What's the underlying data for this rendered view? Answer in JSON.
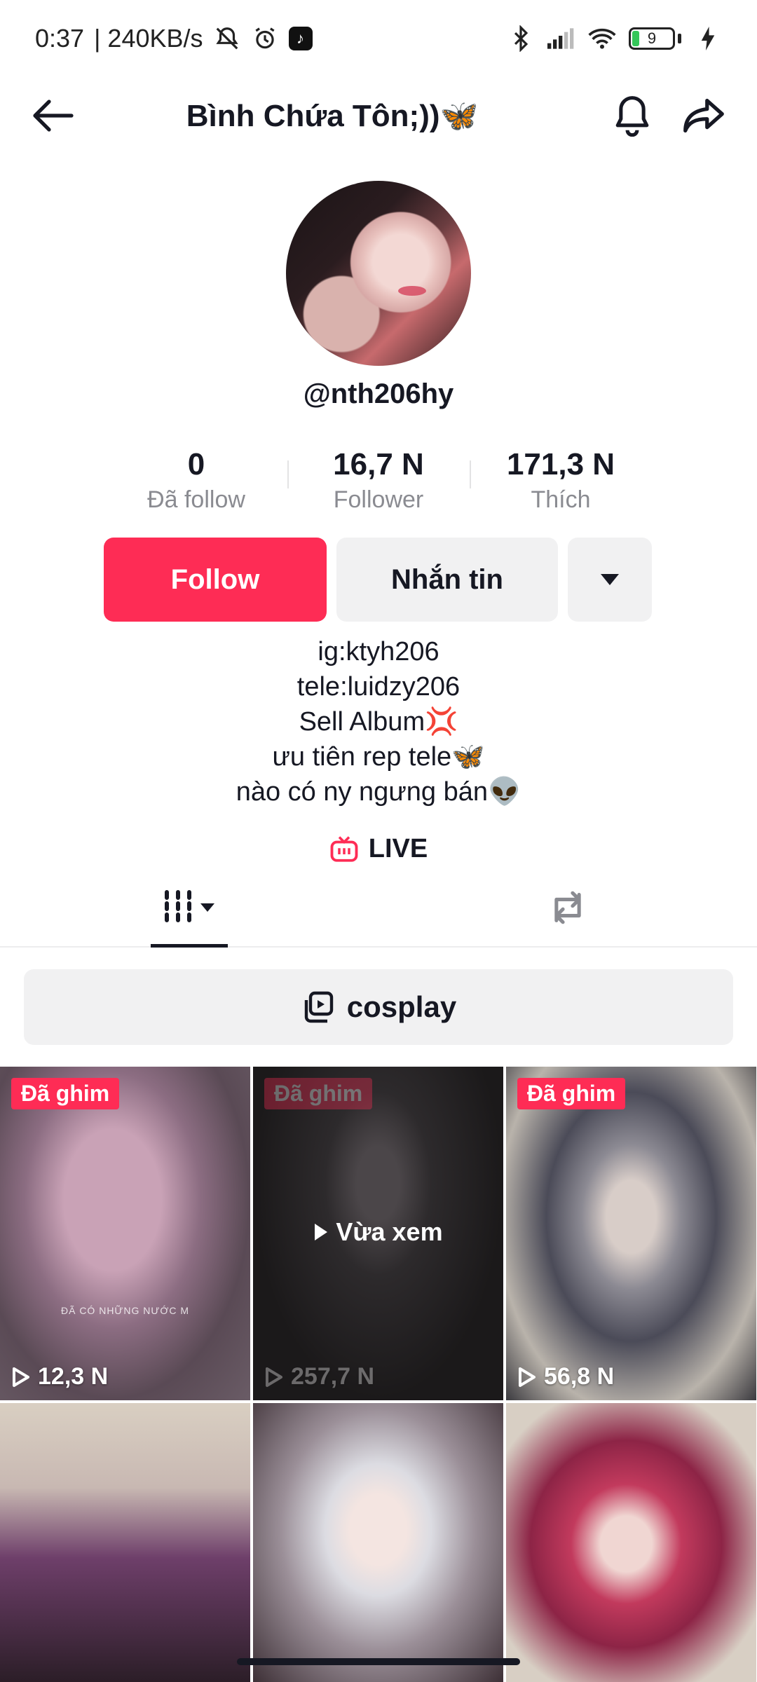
{
  "status_bar": {
    "time": "0:37",
    "network_speed": "| 240KB/s",
    "battery_level": "9",
    "icons": [
      "mute-icon",
      "alarm-icon",
      "tiktok-icon",
      "bluetooth-icon",
      "signal-icon",
      "wifi-icon",
      "battery-icon",
      "charging-icon"
    ]
  },
  "header": {
    "title": "Bình Chứa Tôn;))🦋",
    "icons": [
      "back-arrow-icon",
      "bell-icon",
      "share-icon"
    ]
  },
  "profile": {
    "handle": "@nth206hy"
  },
  "stats": [
    {
      "value": "0",
      "label": "Đã follow"
    },
    {
      "value": "16,7 N",
      "label": "Follower"
    },
    {
      "value": "171,3 N",
      "label": "Thích"
    }
  ],
  "actions": {
    "follow_label": "Follow",
    "message_label": "Nhắn tin",
    "colors": {
      "follow_bg": "#fe2c55",
      "secondary_bg": "#f1f1f2"
    }
  },
  "bio": [
    "ig:ktyh206",
    "tele:luidzy206",
    "Sell Album💢",
    "ưu tiên rep tele🦋",
    "nào có ny ngưng bán👽"
  ],
  "live": {
    "label": "LIVE"
  },
  "playlist": {
    "label": "cosplay"
  },
  "videos": [
    {
      "pinned_label": "Đã ghim",
      "views": "12,3 N",
      "overlay_text": "ĐÃ CÓ NHỮNG NƯỚC M"
    },
    {
      "pinned_label": "Đã ghim",
      "views": "257,7 N",
      "watched_label": "Vừa xem"
    },
    {
      "pinned_label": "Đã ghim",
      "views": "56,8 N"
    },
    {},
    {},
    {}
  ]
}
